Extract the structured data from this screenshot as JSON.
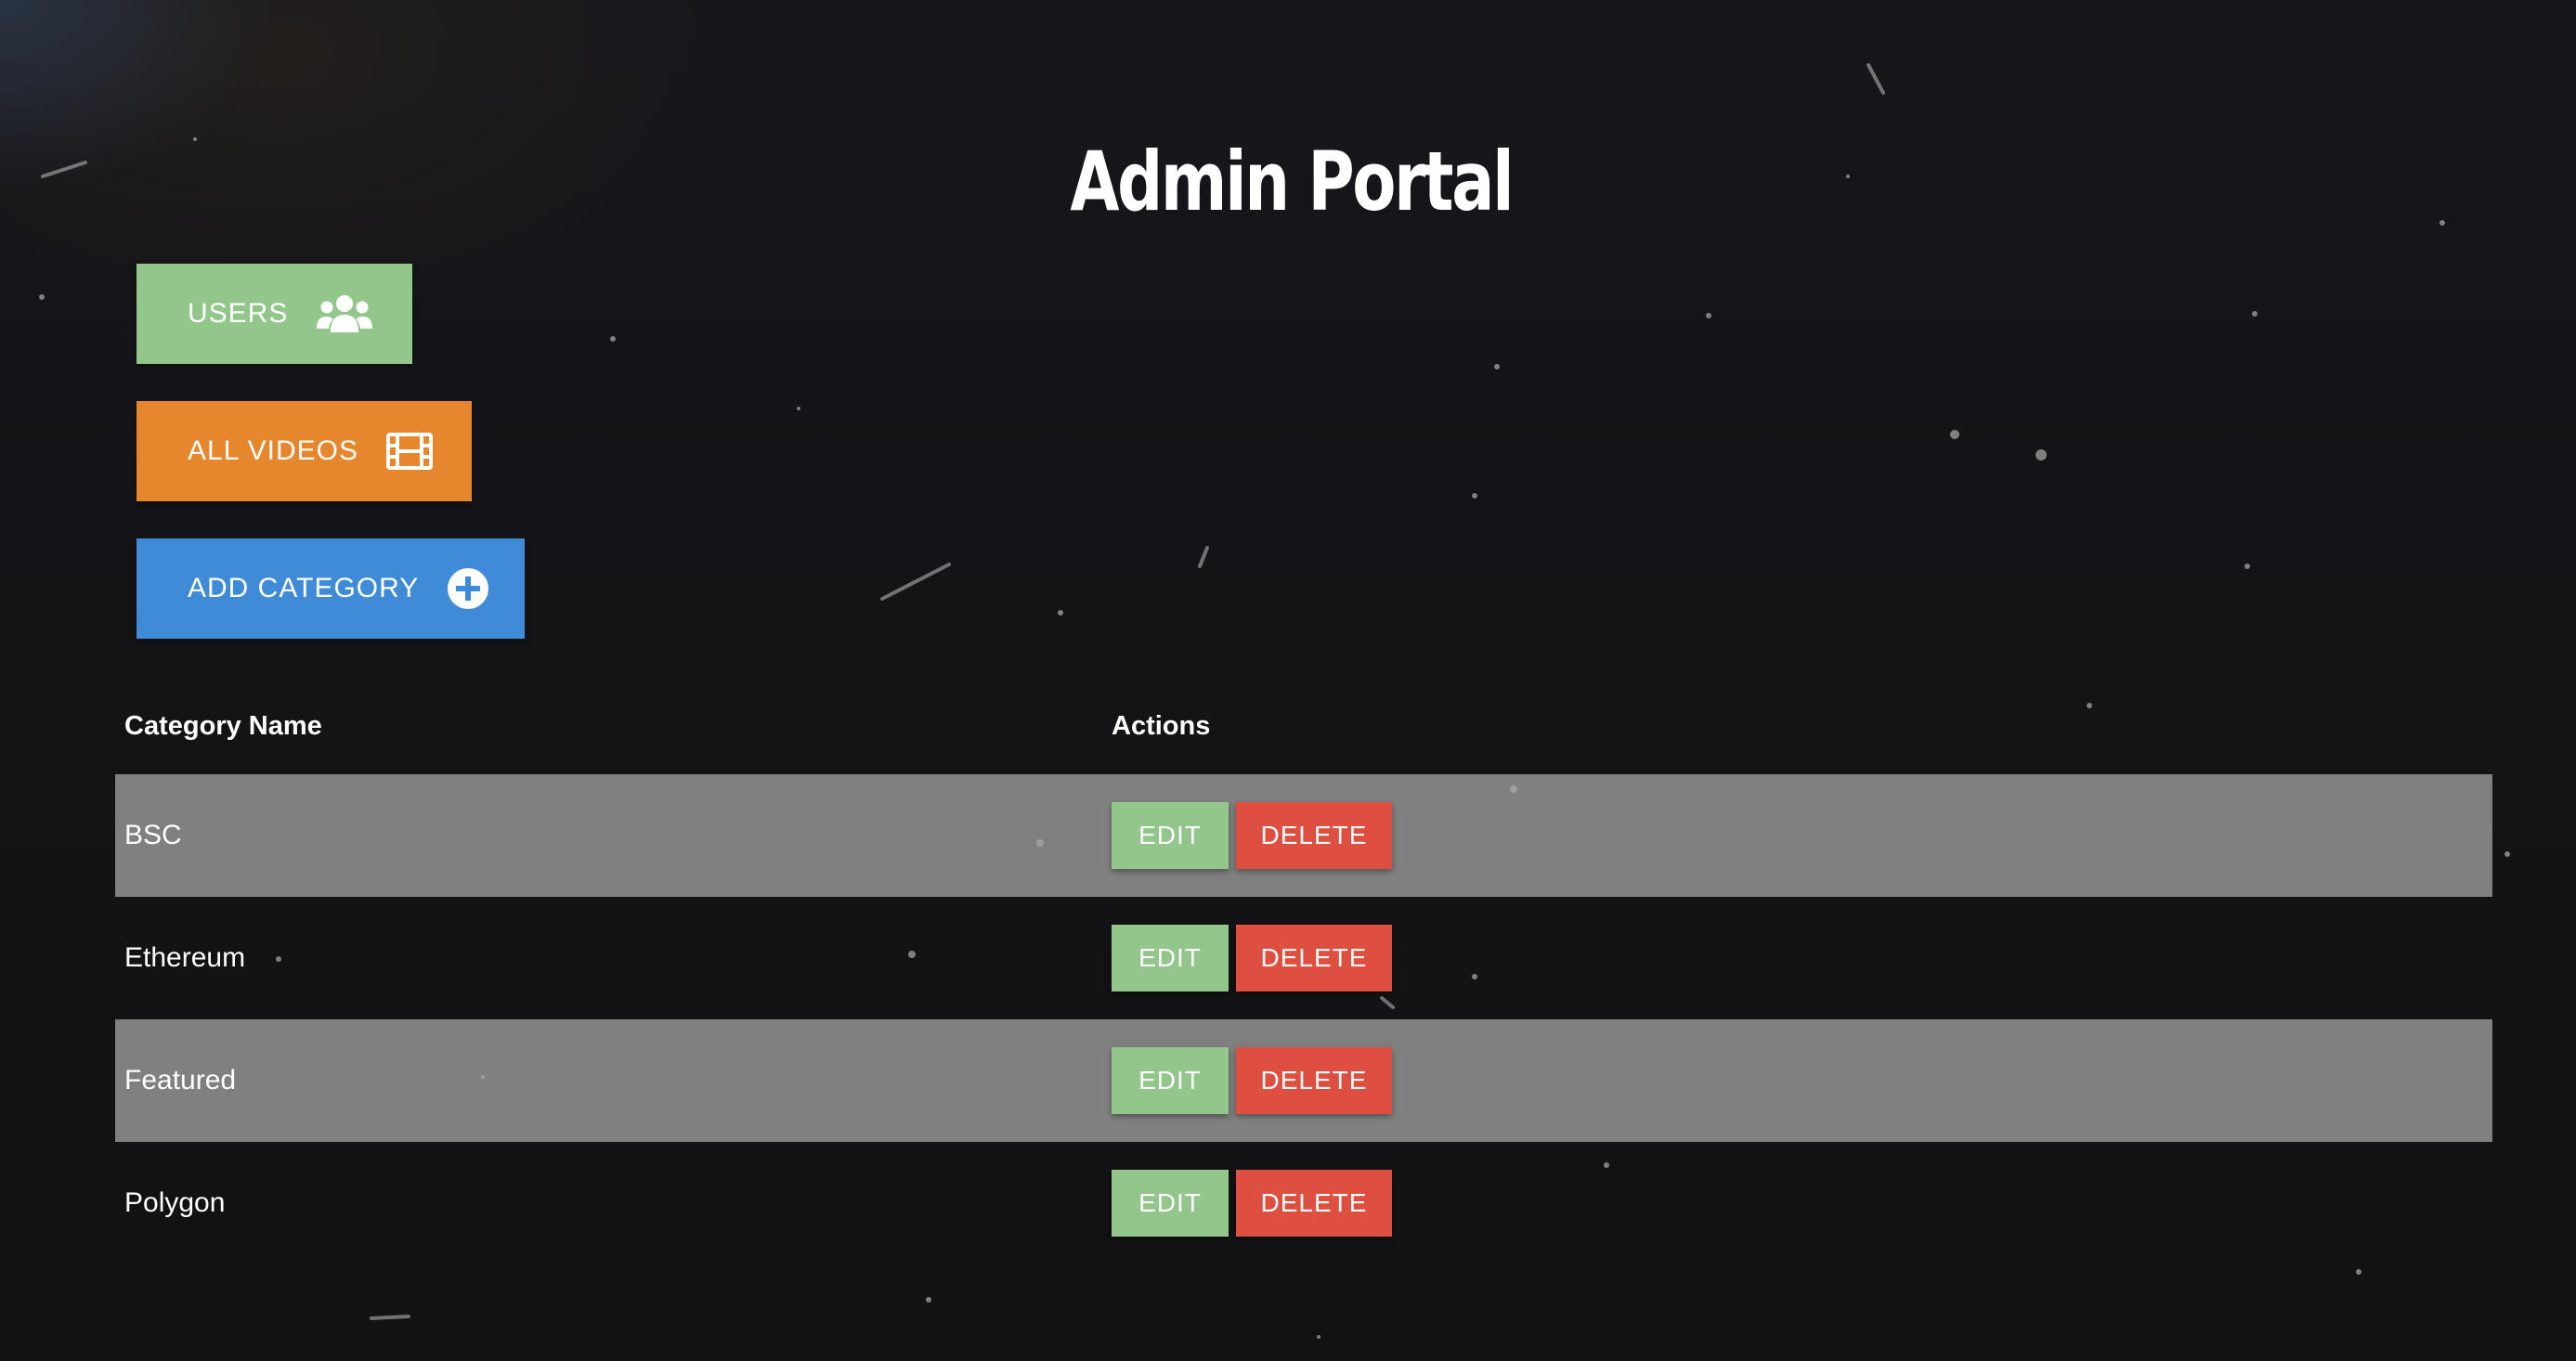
{
  "page": {
    "title": "Admin Portal"
  },
  "nav": {
    "users_label": "USERS",
    "users_icon": "users-icon",
    "videos_label": "ALL VIDEOS",
    "videos_icon": "film-icon",
    "add_category_label": "ADD CATEGORY",
    "add_category_icon": "plus-circle-icon"
  },
  "table": {
    "headers": {
      "name": "Category Name",
      "actions": "Actions"
    },
    "rows": [
      {
        "name": "BSC",
        "edit": "EDIT",
        "delete": "DELETE"
      },
      {
        "name": "Ethereum",
        "edit": "EDIT",
        "delete": "DELETE"
      },
      {
        "name": "Featured",
        "edit": "EDIT",
        "delete": "DELETE"
      },
      {
        "name": "Polygon",
        "edit": "EDIT",
        "delete": "DELETE"
      }
    ]
  },
  "colors": {
    "users_button": "#93c68b",
    "videos_button": "#e6862d",
    "add_button": "#3f8bd8",
    "edit_button": "#93c68b",
    "delete_button": "#df4f40",
    "shaded_row": "#8a8a8a"
  }
}
